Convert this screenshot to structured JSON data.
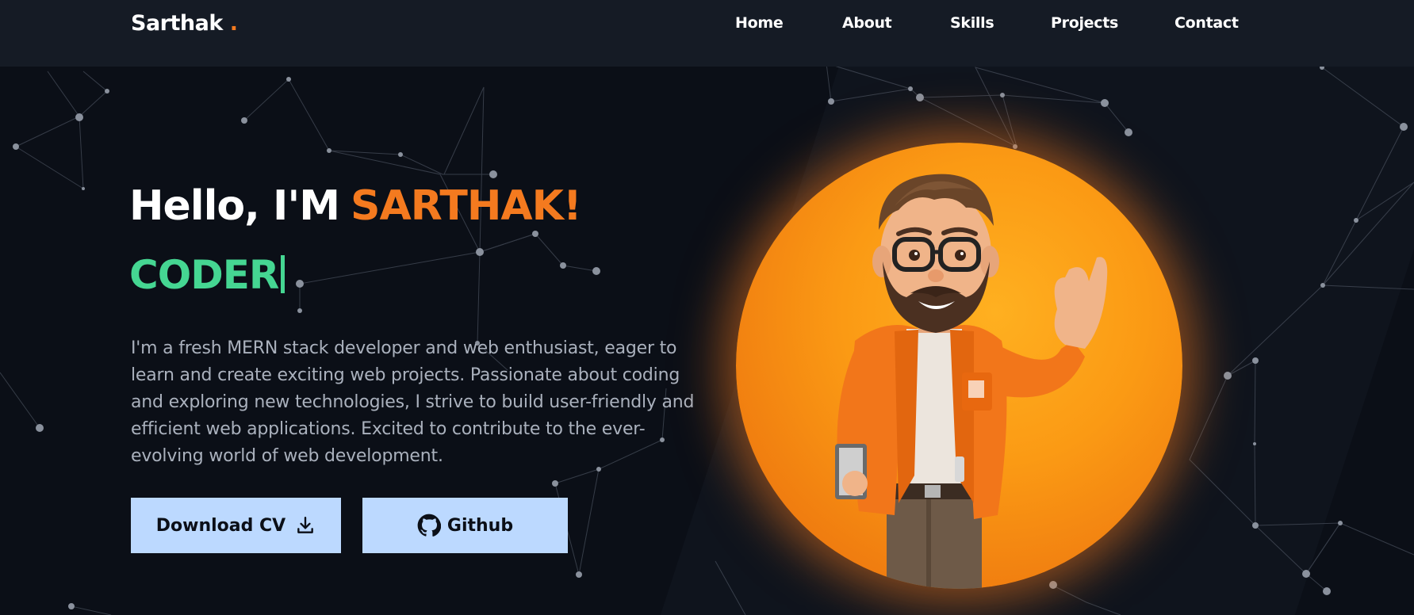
{
  "header": {
    "brand": "Sarthak",
    "brand_dot": ".",
    "nav": [
      {
        "label": "Home"
      },
      {
        "label": "About"
      },
      {
        "label": "Skills"
      },
      {
        "label": "Projects"
      },
      {
        "label": "Contact"
      }
    ]
  },
  "hero": {
    "greeting": "Hello, I'M",
    "name": "SARTHAK!",
    "role": "CODER",
    "bio": "I'm a fresh MERN stack developer and web enthusiast, eager to learn and create exciting web projects. Passionate about coding and exploring new technologies, I strive to build user-friendly and efficient web applications. Excited to contribute to the ever-evolving world of web development.",
    "buttons": {
      "download_cv": "Download CV",
      "github": "Github"
    }
  },
  "icons": {
    "download": "download-icon",
    "github": "github-icon"
  },
  "colors": {
    "background": "#0b0f17",
    "navbar": "#151b25",
    "accent_orange": "#f47a1f",
    "accent_green": "#45d692",
    "button_bg": "#bcd9ff",
    "body_text": "#aab1bd"
  }
}
